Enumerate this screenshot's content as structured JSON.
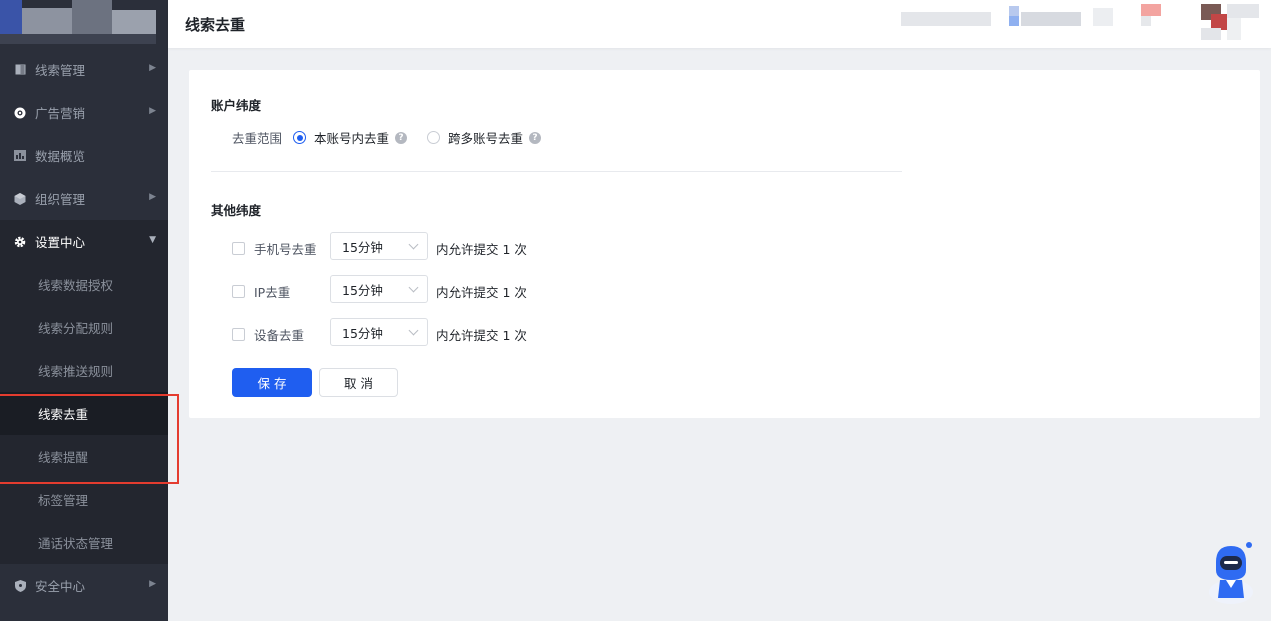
{
  "header": {
    "title": "线索去重"
  },
  "sidebar": {
    "items": [
      {
        "label": "线索管理",
        "icon": "book-icon",
        "has_arrow": true
      },
      {
        "label": "广告营销",
        "icon": "target-icon",
        "has_arrow": true
      },
      {
        "label": "数据概览",
        "icon": "chart-icon",
        "has_arrow": false
      },
      {
        "label": "组织管理",
        "icon": "cube-icon",
        "has_arrow": true
      },
      {
        "label": "设置中心",
        "icon": "gear-icon",
        "has_arrow": true,
        "open": true
      },
      {
        "label": "安全中心",
        "icon": "shield-icon",
        "has_arrow": true
      }
    ],
    "sub_items": [
      {
        "label": "线索数据授权"
      },
      {
        "label": "线索分配规则"
      },
      {
        "label": "线索推送规则"
      },
      {
        "label": "线索去重",
        "active": true
      },
      {
        "label": "线索提醒"
      },
      {
        "label": "标签管理"
      },
      {
        "label": "通话状态管理"
      }
    ]
  },
  "account": {
    "section_title": "账户纬度",
    "scope_label": "去重范围",
    "options": [
      {
        "label": "本账号内去重",
        "checked": true
      },
      {
        "label": "跨多账号去重",
        "checked": false
      }
    ]
  },
  "other": {
    "section_title": "其他纬度",
    "rows": [
      {
        "label": "手机号去重",
        "select": "15分钟",
        "suffix": "内允许提交 1 次"
      },
      {
        "label": "IP去重",
        "select": "15分钟",
        "suffix": "内允许提交 1 次"
      },
      {
        "label": "设备去重",
        "select": "15分钟",
        "suffix": "内允许提交 1 次"
      }
    ]
  },
  "actions": {
    "save": "保 存",
    "cancel": "取 消"
  },
  "colors": {
    "primary": "#1f5ef0",
    "sidebar": "#2b2f3a",
    "highlight": "#e43c2f"
  }
}
